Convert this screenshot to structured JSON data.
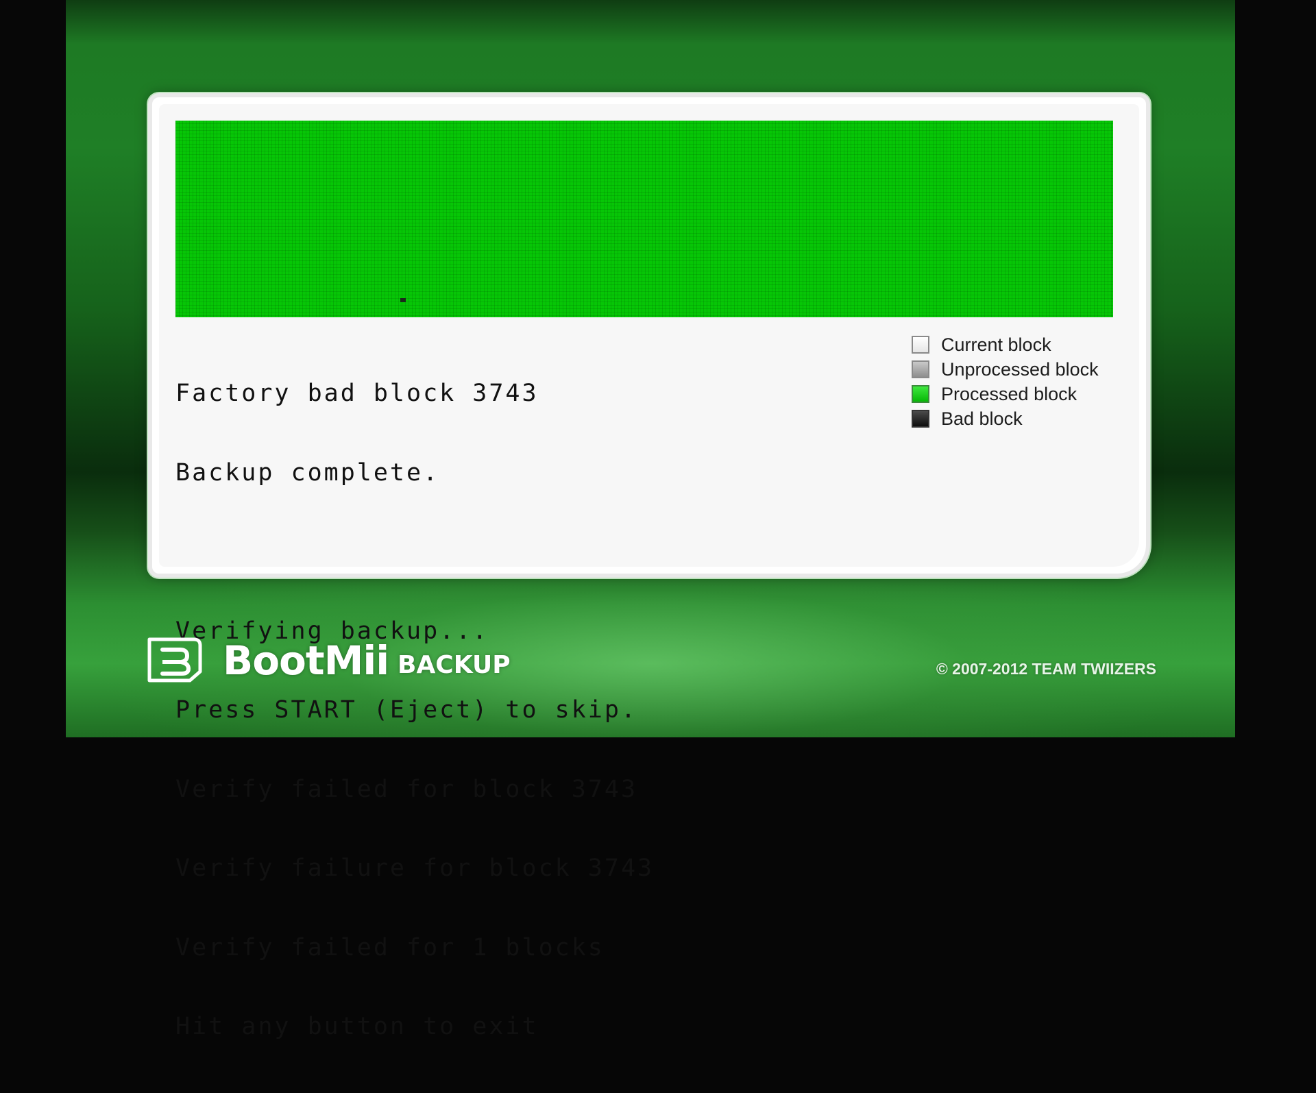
{
  "app": {
    "brand": "BootMii",
    "subtitle": "BACKUP",
    "copyright": "© 2007-2012 TEAM TWIIZERS",
    "logo_icon": "bootmii-logo-icon"
  },
  "block_map": {
    "state": "processed",
    "bad_block_count": 1
  },
  "log": {
    "lines": [
      "Factory bad block 3743",
      "Backup complete.",
      "",
      "Verifying backup...",
      "Press START (Eject) to skip.",
      "Verify failed for block 3743",
      "Verify failure for block 3743",
      "Verify failed for 1 blocks",
      "Hit any button to exit"
    ]
  },
  "legend": {
    "items": [
      {
        "label": "Current block",
        "color": "#f4f4f4"
      },
      {
        "label": "Unprocessed block",
        "color": "#a9a9a9"
      },
      {
        "label": "Processed block",
        "color": "#0ad40a"
      },
      {
        "label": "Bad block",
        "color": "#1c1c1c"
      }
    ]
  },
  "colors": {
    "processed": "#06c606",
    "panel": "#f7f7f7",
    "background": "#1e7a24"
  }
}
